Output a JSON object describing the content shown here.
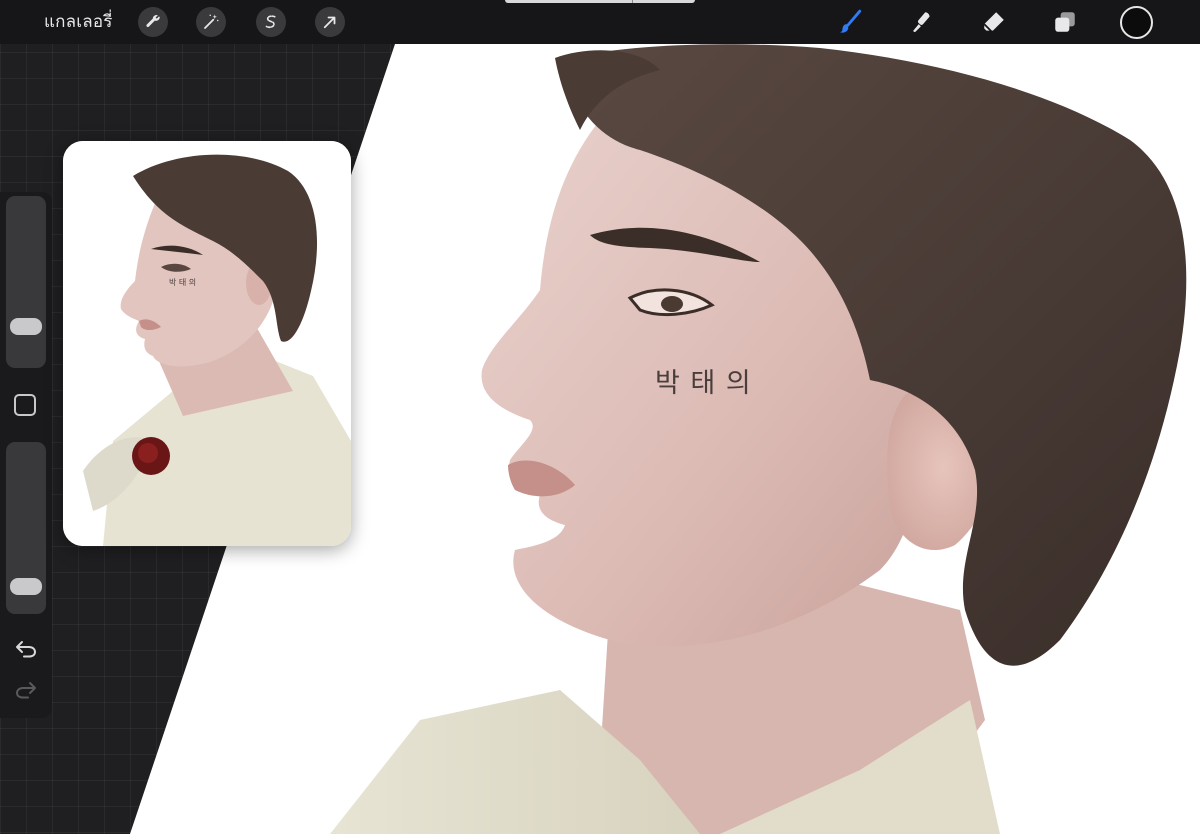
{
  "topbar": {
    "gallery_label": "แกลเลอรี่",
    "left_tools": [
      {
        "icon": "wrench-icon",
        "name": "actions"
      },
      {
        "icon": "magic-wand-icon",
        "name": "adjustments"
      },
      {
        "icon": "selection-s-icon",
        "name": "selection"
      },
      {
        "icon": "arrow-cursor-icon",
        "name": "transform"
      }
    ],
    "right_tools": [
      {
        "icon": "brush-icon",
        "name": "paint",
        "active": true
      },
      {
        "icon": "smudge-icon",
        "name": "smudge"
      },
      {
        "icon": "eraser-icon",
        "name": "eraser"
      },
      {
        "icon": "layers-icon",
        "name": "layers"
      }
    ],
    "current_color": "#0c0c0d",
    "active_color": "#2f7cf6"
  },
  "sidebar": {
    "brush_size_level": 0.8,
    "opacity_level": 0.9,
    "modify_icon": "square-icon",
    "undo_icon": "undo-icon",
    "redo_icon": "redo-icon"
  },
  "canvas": {
    "cheek_text": "박 태 의"
  },
  "reference": {
    "cheek_text": "박 태 의"
  }
}
